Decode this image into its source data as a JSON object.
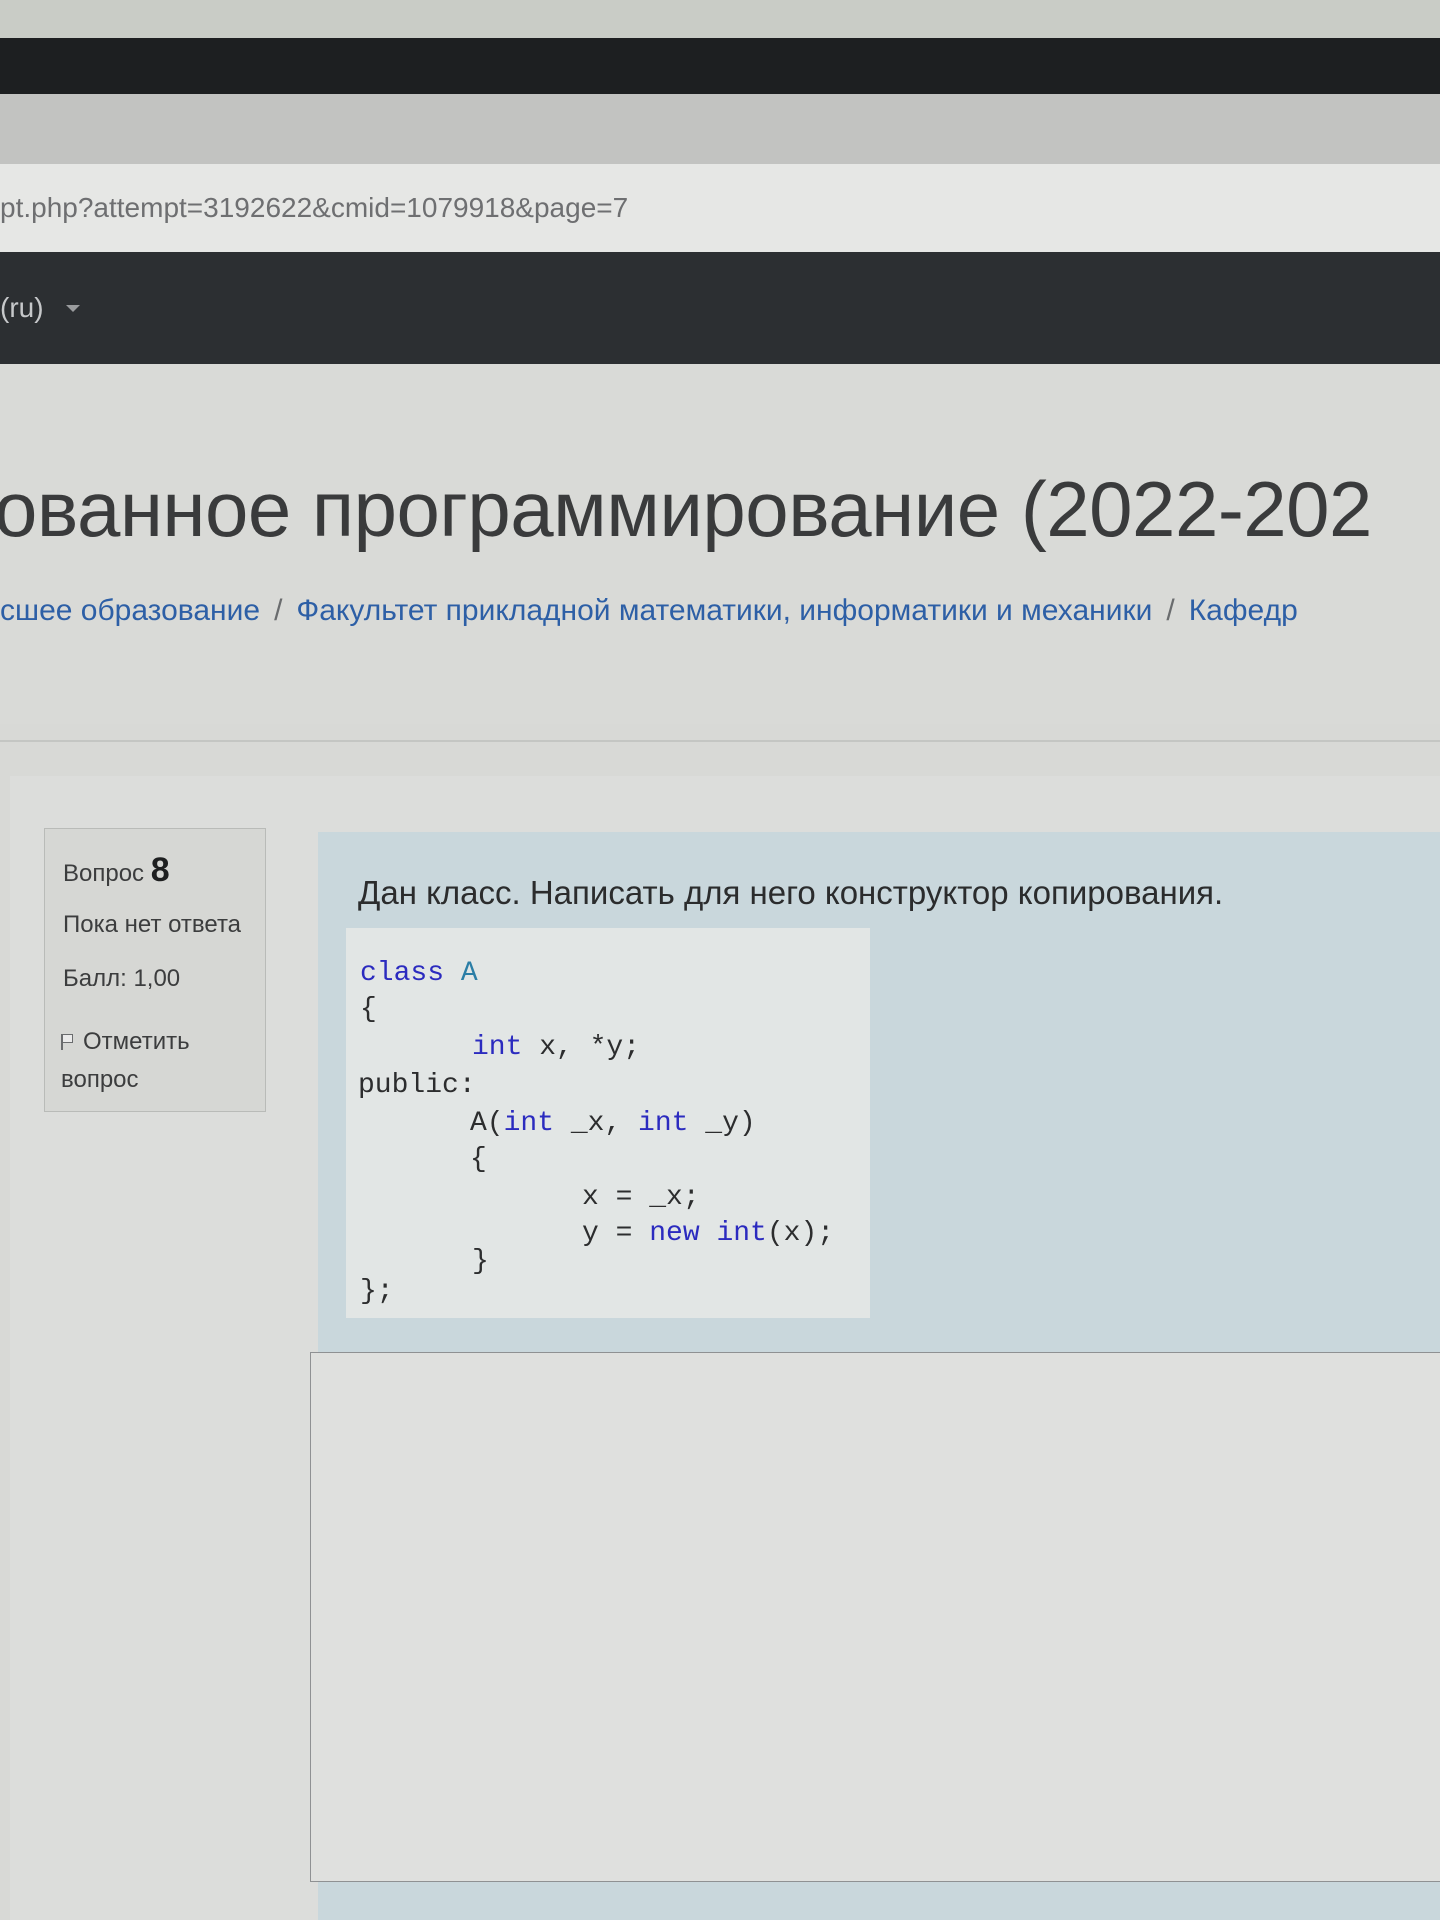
{
  "browser": {
    "url": "pt.php?attempt=3192622&cmid=1079918&page=7"
  },
  "navbar": {
    "language": "(ru)"
  },
  "header": {
    "course_title": "ованное программирование (2022-202",
    "breadcrumbs": [
      "сшее образование",
      "Факультет прикладной математики, информатики и механики",
      "Кафедр"
    ]
  },
  "question_info": {
    "label": "Вопрос",
    "number": "8",
    "state": "Пока нет ответа",
    "grade": "Балл: 1,00",
    "flag_line1": "Отметить",
    "flag_line2": "вопрос"
  },
  "question": {
    "text": "Дан класс. Написать для него конструктор копирования.",
    "code": {
      "class_kw": "class",
      "class_name": "A",
      "open_brace": "{",
      "int1": "int",
      "decl": " x, *y;",
      "public": "public:",
      "ctor_name": "A(",
      "int2": "int",
      "param1": " _x, ",
      "int3": "int",
      "param2": " _y)",
      "ctor_open": "{",
      "assign_x": "x = _x;",
      "assign_y_left": "y = ",
      "new_kw": "new",
      "int4": "int",
      "assign_y_right": "(x);",
      "ctor_close": "}",
      "class_close": "};"
    }
  },
  "answer": {
    "value": ""
  }
}
